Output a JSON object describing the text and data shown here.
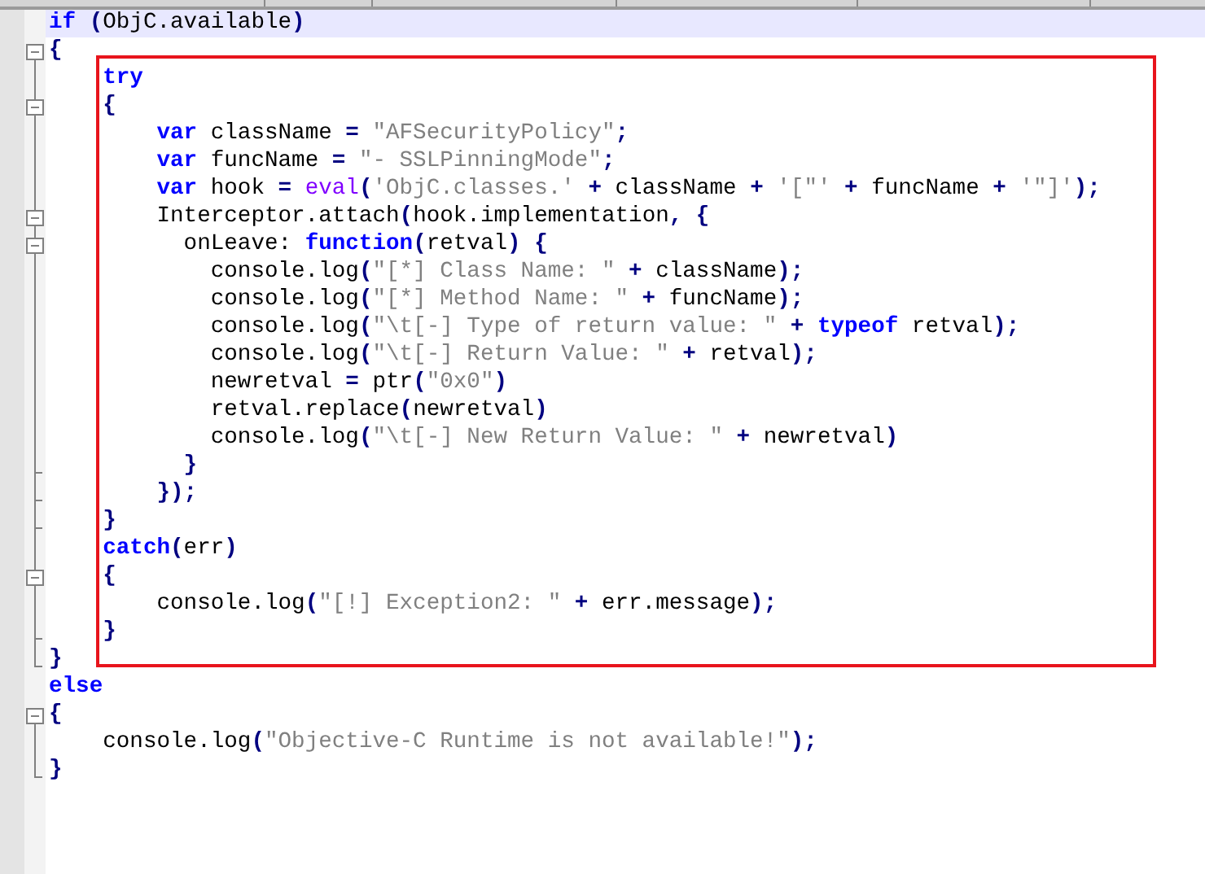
{
  "editor": {
    "lines": [
      {
        "current": true,
        "tokens": [
          {
            "kind": "keyword",
            "text": "if"
          },
          {
            "kind": "op",
            "text": " ("
          },
          {
            "kind": "plain",
            "text": "ObjC.available"
          },
          {
            "kind": "op",
            "text": ")"
          }
        ]
      },
      {
        "current": false,
        "tokens": [
          {
            "kind": "op",
            "text": "{"
          }
        ]
      },
      {
        "current": false,
        "tokens": [
          {
            "kind": "keyword",
            "text": "    try"
          }
        ]
      },
      {
        "current": false,
        "tokens": [
          {
            "kind": "op",
            "text": "    {"
          }
        ]
      },
      {
        "current": false,
        "tokens": [
          {
            "kind": "keyword",
            "text": "        var"
          },
          {
            "kind": "plain",
            "text": " className"
          },
          {
            "kind": "op",
            "text": " = "
          },
          {
            "kind": "string",
            "text": "\"AFSecurityPolicy\""
          },
          {
            "kind": "op",
            "text": ";"
          }
        ]
      },
      {
        "current": false,
        "tokens": [
          {
            "kind": "keyword",
            "text": "        var"
          },
          {
            "kind": "plain",
            "text": " funcName"
          },
          {
            "kind": "op",
            "text": " = "
          },
          {
            "kind": "string",
            "text": "\"- SSLPinningMode\""
          },
          {
            "kind": "op",
            "text": ";"
          }
        ]
      },
      {
        "current": false,
        "tokens": [
          {
            "kind": "keyword",
            "text": "        var"
          },
          {
            "kind": "plain",
            "text": " hook"
          },
          {
            "kind": "op",
            "text": " = "
          },
          {
            "kind": "builtin",
            "text": "eval"
          },
          {
            "kind": "op",
            "text": "("
          },
          {
            "kind": "string",
            "text": "'ObjC.classes.'"
          },
          {
            "kind": "op",
            "text": " + "
          },
          {
            "kind": "plain",
            "text": "className"
          },
          {
            "kind": "op",
            "text": " + "
          },
          {
            "kind": "string",
            "text": "'[\"'"
          },
          {
            "kind": "op",
            "text": " + "
          },
          {
            "kind": "plain",
            "text": "funcName"
          },
          {
            "kind": "op",
            "text": " + "
          },
          {
            "kind": "string",
            "text": "'\"]'"
          },
          {
            "kind": "op",
            "text": ");"
          }
        ]
      },
      {
        "current": false,
        "tokens": [
          {
            "kind": "plain",
            "text": "        Interceptor.attach"
          },
          {
            "kind": "op",
            "text": "("
          },
          {
            "kind": "plain",
            "text": "hook.implementation"
          },
          {
            "kind": "op",
            "text": ", {"
          }
        ]
      },
      {
        "current": false,
        "tokens": [
          {
            "kind": "plain",
            "text": "          onLeave: "
          },
          {
            "kind": "keyword",
            "text": "function"
          },
          {
            "kind": "op",
            "text": "("
          },
          {
            "kind": "plain",
            "text": "retval"
          },
          {
            "kind": "op",
            "text": ") {"
          }
        ]
      },
      {
        "current": false,
        "tokens": [
          {
            "kind": "plain",
            "text": "            console.log"
          },
          {
            "kind": "op",
            "text": "("
          },
          {
            "kind": "string",
            "text": "\"[*] Class Name: \""
          },
          {
            "kind": "op",
            "text": " + "
          },
          {
            "kind": "plain",
            "text": "className"
          },
          {
            "kind": "op",
            "text": ");"
          }
        ]
      },
      {
        "current": false,
        "tokens": [
          {
            "kind": "plain",
            "text": "            console.log"
          },
          {
            "kind": "op",
            "text": "("
          },
          {
            "kind": "string",
            "text": "\"[*] Method Name: \""
          },
          {
            "kind": "op",
            "text": " + "
          },
          {
            "kind": "plain",
            "text": "funcName"
          },
          {
            "kind": "op",
            "text": ");"
          }
        ]
      },
      {
        "current": false,
        "tokens": [
          {
            "kind": "plain",
            "text": "            console.log"
          },
          {
            "kind": "op",
            "text": "("
          },
          {
            "kind": "string",
            "text": "\"\\t[-] Type of return value: \""
          },
          {
            "kind": "op",
            "text": " + "
          },
          {
            "kind": "keyword",
            "text": "typeof"
          },
          {
            "kind": "plain",
            "text": " retval"
          },
          {
            "kind": "op",
            "text": ");"
          }
        ]
      },
      {
        "current": false,
        "tokens": [
          {
            "kind": "plain",
            "text": "            console.log"
          },
          {
            "kind": "op",
            "text": "("
          },
          {
            "kind": "string",
            "text": "\"\\t[-] Return Value: \""
          },
          {
            "kind": "op",
            "text": " + "
          },
          {
            "kind": "plain",
            "text": "retval"
          },
          {
            "kind": "op",
            "text": ");"
          }
        ]
      },
      {
        "current": false,
        "tokens": [
          {
            "kind": "plain",
            "text": "            newretval"
          },
          {
            "kind": "op",
            "text": " = "
          },
          {
            "kind": "plain",
            "text": "ptr"
          },
          {
            "kind": "op",
            "text": "("
          },
          {
            "kind": "string",
            "text": "\"0x0\""
          },
          {
            "kind": "op",
            "text": ")"
          }
        ]
      },
      {
        "current": false,
        "tokens": [
          {
            "kind": "plain",
            "text": "            retval.replace"
          },
          {
            "kind": "op",
            "text": "("
          },
          {
            "kind": "plain",
            "text": "newretval"
          },
          {
            "kind": "op",
            "text": ")"
          }
        ]
      },
      {
        "current": false,
        "tokens": [
          {
            "kind": "plain",
            "text": "            console.log"
          },
          {
            "kind": "op",
            "text": "("
          },
          {
            "kind": "string",
            "text": "\"\\t[-] New Return Value: \""
          },
          {
            "kind": "op",
            "text": " + "
          },
          {
            "kind": "plain",
            "text": "newretval"
          },
          {
            "kind": "op",
            "text": ")"
          }
        ]
      },
      {
        "current": false,
        "tokens": [
          {
            "kind": "op",
            "text": "          }"
          }
        ]
      },
      {
        "current": false,
        "tokens": [
          {
            "kind": "op",
            "text": "        });"
          }
        ]
      },
      {
        "current": false,
        "tokens": [
          {
            "kind": "op",
            "text": "    }"
          }
        ]
      },
      {
        "current": false,
        "tokens": [
          {
            "kind": "keyword",
            "text": "    catch"
          },
          {
            "kind": "op",
            "text": "("
          },
          {
            "kind": "plain",
            "text": "err"
          },
          {
            "kind": "op",
            "text": ")"
          }
        ]
      },
      {
        "current": false,
        "tokens": [
          {
            "kind": "op",
            "text": "    {"
          }
        ]
      },
      {
        "current": false,
        "tokens": [
          {
            "kind": "plain",
            "text": "        console.log"
          },
          {
            "kind": "op",
            "text": "("
          },
          {
            "kind": "string",
            "text": "\"[!] Exception2: \""
          },
          {
            "kind": "op",
            "text": " + "
          },
          {
            "kind": "plain",
            "text": "err.message"
          },
          {
            "kind": "op",
            "text": ");"
          }
        ]
      },
      {
        "current": false,
        "tokens": [
          {
            "kind": "op",
            "text": "    }"
          }
        ]
      },
      {
        "current": false,
        "tokens": [
          {
            "kind": "op",
            "text": "}"
          }
        ]
      },
      {
        "current": false,
        "tokens": [
          {
            "kind": "keyword",
            "text": "else"
          }
        ]
      },
      {
        "current": false,
        "tokens": [
          {
            "kind": "op",
            "text": "{"
          }
        ]
      },
      {
        "current": false,
        "tokens": [
          {
            "kind": "plain",
            "text": "    console.log"
          },
          {
            "kind": "op",
            "text": "("
          },
          {
            "kind": "string",
            "text": "\"Objective-C Runtime is not available!\""
          },
          {
            "kind": "op",
            "text": ");"
          }
        ]
      },
      {
        "current": false,
        "tokens": [
          {
            "kind": "op",
            "text": "}"
          }
        ]
      }
    ]
  },
  "annotation": {
    "kind": "frame"
  }
}
